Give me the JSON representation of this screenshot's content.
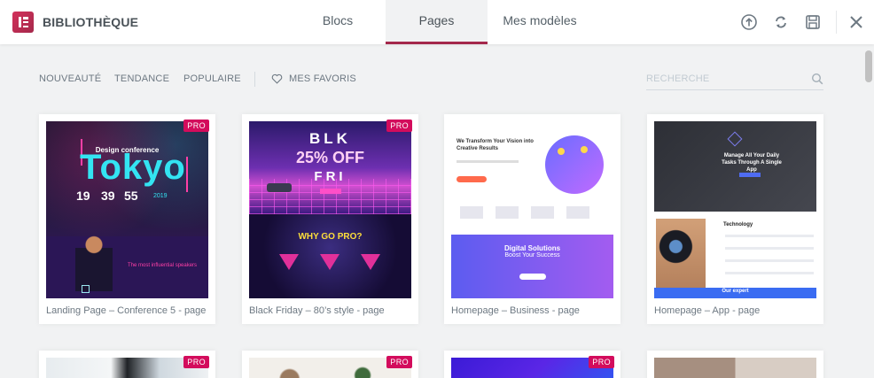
{
  "header": {
    "brand": "BIBLIOTHÈQUE",
    "tabs": [
      {
        "label": "Blocs"
      },
      {
        "label": "Pages"
      },
      {
        "label": "Mes modèles"
      }
    ],
    "active_tab": "Pages",
    "accent_color": "#a4284b"
  },
  "filters": {
    "items": [
      "NOUVEAUTÉ",
      "TENDANCE",
      "POPULAIRE"
    ],
    "favorites_label": "MES FAVORIS",
    "search_placeholder": "RECHERCHE"
  },
  "cards": [
    {
      "title": "Landing Page – Conference 5 - page",
      "badge": "PRO",
      "thumb": {
        "big": "Tokyo",
        "kicker": "Design conference",
        "year": "2019",
        "times": [
          "19",
          "39",
          "55"
        ],
        "caption": "The most influential speakers"
      }
    },
    {
      "title": "Black Friday – 80’s style - page",
      "badge": "PRO",
      "thumb": {
        "line1": "BLK",
        "line2": "25% OFF",
        "line3": "FRI",
        "cta": "WHY GO PRO?"
      }
    },
    {
      "title": "Homepage – Business - page",
      "badge": "",
      "thumb": {
        "headline": "We Transform Your Vision into Creative Results",
        "band_title": "Digital Solutions",
        "band_sub": "Boost Your Success"
      }
    },
    {
      "title": "Homepage – App - page",
      "badge": "",
      "thumb": {
        "headline": "Manage All Your Daily Tasks Through A Single App",
        "section": "Technology",
        "footer": "Our expert"
      }
    }
  ],
  "row2_badges": [
    "PRO",
    "PRO",
    "PRO"
  ]
}
